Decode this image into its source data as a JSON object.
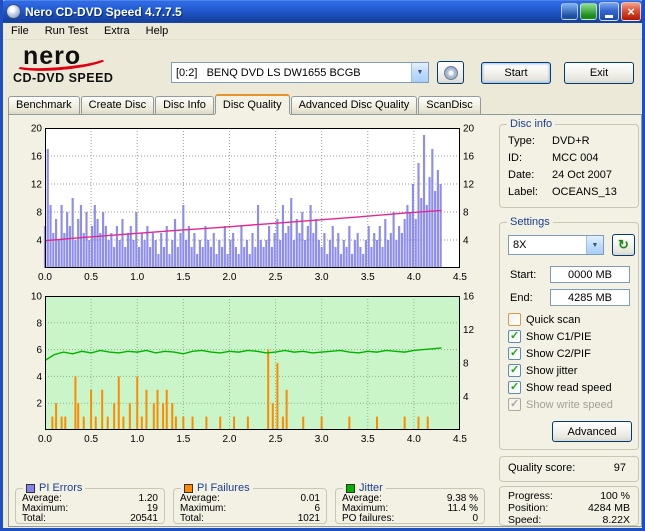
{
  "window": {
    "title": "Nero CD-DVD Speed 4.7.7.5"
  },
  "menu": {
    "items": [
      "File",
      "Run Test",
      "Extra",
      "Help"
    ]
  },
  "header": {
    "logo_line1": "nero",
    "logo_line2": "CD-DVD SPEED",
    "drive_value": "[0:2]   BENQ DVD LS DW1655 BCGB",
    "start_label": "Start",
    "exit_label": "Exit"
  },
  "tabs": {
    "items": [
      "Benchmark",
      "Create Disc",
      "Disc Info",
      "Disc Quality",
      "Advanced Disc Quality",
      "ScanDisc"
    ],
    "active": "Disc Quality"
  },
  "disc_info": {
    "title": "Disc info",
    "rows": [
      {
        "label": "Type:",
        "value": "DVD+R"
      },
      {
        "label": "ID:",
        "value": "MCC 004"
      },
      {
        "label": "Date:",
        "value": "24 Oct 2007"
      },
      {
        "label": "Label:",
        "value": "OCEANS_13"
      }
    ]
  },
  "settings": {
    "title": "Settings",
    "speed_value": "8X",
    "start_label": "Start:",
    "start_value": "0000 MB",
    "end_label": "End:",
    "end_value": "4285 MB",
    "checkboxes": [
      {
        "label": "Quick scan",
        "checked": false,
        "disabled": false
      },
      {
        "label": "Show C1/PIE",
        "checked": true,
        "disabled": false
      },
      {
        "label": "Show C2/PIF",
        "checked": true,
        "disabled": false
      },
      {
        "label": "Show jitter",
        "checked": true,
        "disabled": false
      },
      {
        "label": "Show read speed",
        "checked": true,
        "disabled": false
      },
      {
        "label": "Show write speed",
        "checked": true,
        "disabled": true
      }
    ],
    "advanced_label": "Advanced"
  },
  "quality": {
    "label": "Quality score:",
    "value": "97"
  },
  "status": {
    "rows": [
      {
        "label": "Progress:",
        "value": "100 %"
      },
      {
        "label": "Position:",
        "value": "4284 MB"
      },
      {
        "label": "Speed:",
        "value": "8.22X"
      }
    ]
  },
  "stats": [
    {
      "title": "PI Errors",
      "color": "#8484ec",
      "rows": [
        {
          "label": "Average:",
          "value": "1.20"
        },
        {
          "label": "Maximum:",
          "value": "19"
        },
        {
          "label": "Total:",
          "value": "20541"
        }
      ]
    },
    {
      "title": "PI Failures",
      "color": "#ff8a00",
      "rows": [
        {
          "label": "Average:",
          "value": "0.01"
        },
        {
          "label": "Maximum:",
          "value": "6"
        },
        {
          "label": "Total:",
          "value": "1021"
        }
      ]
    },
    {
      "title": "Jitter",
      "color": "#00b400",
      "rows": [
        {
          "label": "Average:",
          "value": "9.38 %"
        },
        {
          "label": "Maximum:",
          "value": "11.4 %"
        },
        {
          "label": "PO failures:",
          "value": "0"
        }
      ]
    }
  ],
  "chart_data": [
    {
      "type": "bar",
      "title": "PI Errors (bars) and read speed (line)",
      "x": {
        "min": 0,
        "max": 4.5,
        "ticks": [
          "0.0",
          "0.5",
          "1.0",
          "1.5",
          "2.0",
          "2.5",
          "3.0",
          "3.5",
          "4.0",
          "4.5"
        ]
      },
      "y_left": {
        "min": 0,
        "max": 20,
        "ticks": [
          4,
          8,
          12,
          16,
          20
        ]
      },
      "y_right": {
        "min": 0,
        "max": 20,
        "ticks": [
          4,
          8,
          12,
          16,
          20
        ]
      },
      "bg": "#ffffff",
      "grid": "#9a9a9a",
      "series": [
        {
          "name": "PI Errors",
          "kind": "bars",
          "axis": "left",
          "color": "#8484ec",
          "x_start": 0,
          "x_step": 0.03,
          "values": [
            6,
            17,
            9,
            5,
            7,
            4,
            9,
            5,
            8,
            6,
            10,
            4,
            7,
            9,
            5,
            8,
            4,
            6,
            9,
            7,
            5,
            8,
            6,
            4,
            5,
            3,
            6,
            4,
            7,
            3,
            5,
            6,
            4,
            8,
            3,
            5,
            4,
            6,
            3,
            5,
            4,
            2,
            5,
            3,
            6,
            2,
            4,
            7,
            3,
            5,
            9,
            4,
            6,
            3,
            5,
            2,
            4,
            3,
            6,
            4,
            3,
            5,
            2,
            4,
            3,
            6,
            2,
            4,
            5,
            3,
            2,
            6,
            3,
            4,
            2,
            5,
            3,
            9,
            4,
            3,
            4,
            6,
            3,
            5,
            7,
            4,
            9,
            5,
            6,
            10,
            4,
            7,
            5,
            8,
            4,
            6,
            9,
            5,
            7,
            4,
            3,
            5,
            2,
            4,
            6,
            3,
            5,
            2,
            4,
            3,
            6,
            2,
            4,
            5,
            3,
            2,
            4,
            6,
            3,
            5,
            4,
            6,
            3,
            7,
            4,
            5,
            8,
            4,
            6,
            5,
            7,
            9,
            8,
            12,
            7,
            15,
            10,
            19,
            9,
            13,
            17,
            11,
            14,
            12
          ]
        },
        {
          "name": "Read speed",
          "kind": "line",
          "axis": "right",
          "color": "#e02890",
          "points": [
            [
              0,
              3.9
            ],
            [
              0.4,
              4.35
            ],
            [
              0.9,
              4.85
            ],
            [
              1.4,
              5.35
            ],
            [
              1.9,
              5.8
            ],
            [
              2.4,
              6.3
            ],
            [
              2.9,
              6.8
            ],
            [
              3.4,
              7.3
            ],
            [
              3.9,
              7.85
            ],
            [
              4.3,
              8.22
            ]
          ]
        }
      ]
    },
    {
      "type": "bar",
      "title": "PI Failures (bars) and jitter (line)",
      "x": {
        "min": 0,
        "max": 4.5,
        "ticks": [
          "0.0",
          "0.5",
          "1.0",
          "1.5",
          "2.0",
          "2.5",
          "3.0",
          "3.5",
          "4.0",
          "4.5"
        ]
      },
      "y_left": {
        "min": 0,
        "max": 10,
        "ticks": [
          2,
          4,
          6,
          8,
          10
        ]
      },
      "y_right": {
        "min": 0,
        "max": 16,
        "ticks": [
          4,
          8,
          12,
          16
        ]
      },
      "bg": "#c9f5c9",
      "grid": "#8fb48f",
      "series": [
        {
          "name": "PI Failures",
          "kind": "spikes",
          "axis": "left",
          "color": "#ff8a00",
          "points": [
            [
              0.08,
              1
            ],
            [
              0.12,
              2
            ],
            [
              0.18,
              1
            ],
            [
              0.22,
              1
            ],
            [
              0.33,
              4
            ],
            [
              0.36,
              2
            ],
            [
              0.42,
              1
            ],
            [
              0.5,
              3
            ],
            [
              0.55,
              1
            ],
            [
              0.62,
              3
            ],
            [
              0.68,
              1
            ],
            [
              0.75,
              2
            ],
            [
              0.8,
              4
            ],
            [
              0.85,
              1
            ],
            [
              0.92,
              2
            ],
            [
              1.0,
              4
            ],
            [
              1.05,
              1
            ],
            [
              1.1,
              3
            ],
            [
              1.18,
              2
            ],
            [
              1.22,
              3
            ],
            [
              1.28,
              2
            ],
            [
              1.32,
              3
            ],
            [
              1.38,
              2
            ],
            [
              1.42,
              1
            ],
            [
              1.5,
              1
            ],
            [
              1.6,
              1
            ],
            [
              1.75,
              1
            ],
            [
              1.9,
              1
            ],
            [
              2.05,
              1
            ],
            [
              2.2,
              1
            ],
            [
              2.42,
              6
            ],
            [
              2.47,
              2
            ],
            [
              2.52,
              5
            ],
            [
              2.58,
              1
            ],
            [
              2.62,
              3
            ],
            [
              2.8,
              1
            ],
            [
              3.0,
              1
            ],
            [
              3.3,
              1
            ],
            [
              3.6,
              1
            ],
            [
              3.9,
              1
            ],
            [
              4.05,
              1
            ],
            [
              4.15,
              1
            ]
          ]
        },
        {
          "name": "Jitter",
          "kind": "line",
          "axis": "right",
          "color": "#00b400",
          "x_start": 0,
          "x_step": 0.1,
          "values": [
            8.3,
            9.0,
            9.3,
            9.1,
            9.4,
            9.2,
            9.5,
            9.3,
            9.2,
            9.4,
            9.3,
            9.5,
            9.2,
            9.4,
            9.3,
            9.1,
            9.4,
            9.5,
            9.3,
            9.2,
            9.4,
            9.3,
            9.5,
            9.4,
            9.2,
            9.3,
            9.5,
            9.3,
            9.4,
            9.2,
            9.3,
            9.4,
            9.5,
            9.3,
            9.2,
            9.4,
            9.3,
            9.5,
            9.4,
            9.3,
            9.5,
            9.6,
            9.7,
            9.8
          ]
        }
      ]
    }
  ]
}
